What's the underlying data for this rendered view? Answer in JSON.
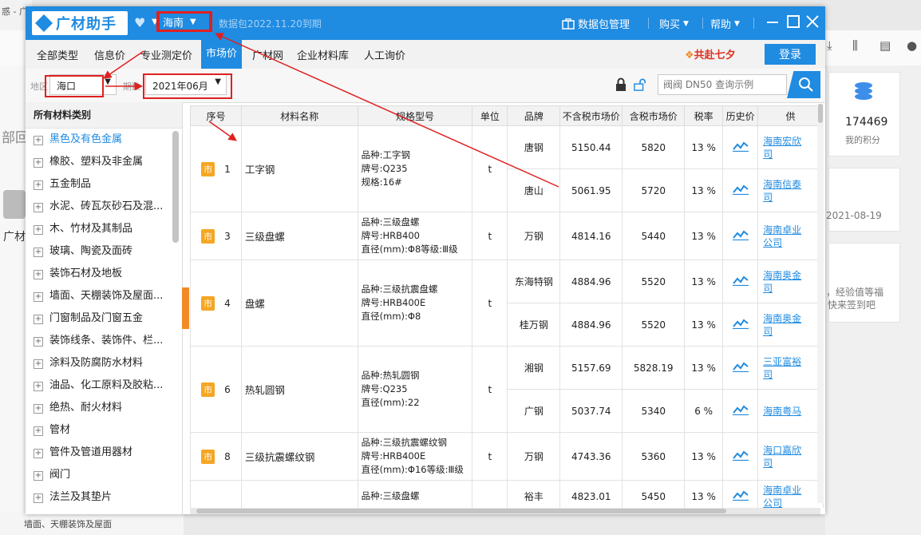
{
  "background": {
    "tab_text": "惑 - 广",
    "points_value": "174469",
    "points_label": "我的积分",
    "date_text": "2021-08-19",
    "checkin_line1": "，经验值等福",
    "checkin_line2": "快来签到吧",
    "side_text_1": "部回",
    "side_text_2": "广材",
    "bottom_text": "墙面、天棚装饰及屋面"
  },
  "app": {
    "logo_text": "广材助手",
    "region": "海南",
    "package_expiry": "数据包2022.11.20到期",
    "package_manage": "数据包管理",
    "buy": "购买",
    "help": "帮助"
  },
  "nav": {
    "tabs": [
      "全部类型",
      "信息价",
      "专业测定价",
      "市场价",
      "广材网",
      "企业材料库",
      "人工询价"
    ],
    "active_tab": "市场价",
    "promo": "共赴七夕",
    "login": "登录"
  },
  "filters": {
    "area_label": "地区",
    "area_value": "海口",
    "period_label": "期数",
    "period_value": "2021年06月",
    "search_placeholder": "阀阀 DN50 查询示例"
  },
  "sidebar": {
    "header": "所有材料类别",
    "active_index": 0,
    "items": [
      "黑色及有色金属",
      "橡胶、塑料及非金属",
      "五金制品",
      "水泥、砖瓦灰砂石及混...",
      "木、竹材及其制品",
      "玻璃、陶瓷及面砖",
      "装饰石材及地板",
      "墙面、天棚装饰及屋面...",
      "门窗制品及门窗五金",
      "装饰线条、装饰件、栏...",
      "涂料及防腐防水材料",
      "油品、化工原料及胶粘...",
      "绝热、耐火材料",
      "管材",
      "管件及管道用器材",
      "阀门",
      "法兰及其垫片"
    ]
  },
  "table": {
    "badge": "市",
    "headers": [
      "序号",
      "材料名称",
      "规格型号",
      "单位",
      "品牌",
      "不含税市场价",
      "含税市场价",
      "税率",
      "历史价",
      "供"
    ],
    "groups": [
      {
        "no": "1",
        "name": "工字钢",
        "spec": [
          "品种:工字钢",
          "牌号:Q235",
          "规格:16#"
        ],
        "unit": "t",
        "rows": [
          {
            "brand": "唐钢",
            "price_ex": "5150.44",
            "price_in": "5820",
            "tax": "13 %",
            "supplier": [
              "海南宏欣",
              "司"
            ]
          },
          {
            "brand": "唐山",
            "price_ex": "5061.95",
            "price_in": "5720",
            "tax": "13 %",
            "supplier": [
              "海南信泰",
              "司"
            ]
          }
        ]
      },
      {
        "no": "3",
        "name": "三级盘螺",
        "spec": [
          "品种:三级盘螺",
          "牌号:HRB400",
          "直径(mm):Φ8等级:Ⅲ级"
        ],
        "unit": "t",
        "rows": [
          {
            "brand": "万钢",
            "price_ex": "4814.16",
            "price_in": "5440",
            "tax": "13 %",
            "supplier": [
              "海南卓业",
              "公司"
            ]
          }
        ]
      },
      {
        "no": "4",
        "name": "盘螺",
        "spec": [
          "品种:三级抗震盘螺",
          "牌号:HRB400E",
          "直径(mm):Φ8"
        ],
        "unit": "t",
        "rows": [
          {
            "brand": "东海特钢",
            "price_ex": "4884.96",
            "price_in": "5520",
            "tax": "13 %",
            "supplier": [
              "海南奥金",
              "司"
            ]
          },
          {
            "brand": "桂万钢",
            "price_ex": "4884.96",
            "price_in": "5520",
            "tax": "13 %",
            "supplier": [
              "海南奥金",
              "司"
            ]
          }
        ]
      },
      {
        "no": "6",
        "name": "热轧圆钢",
        "spec": [
          "品种:热轧圆钢",
          "牌号:Q235",
          "直径(mm):22"
        ],
        "unit": "t",
        "rows": [
          {
            "brand": "湘钢",
            "price_ex": "5157.69",
            "price_in": "5828.19",
            "tax": "13 %",
            "supplier": [
              "三亚富裕",
              "司"
            ]
          },
          {
            "brand": "广钢",
            "price_ex": "5037.74",
            "price_in": "5340",
            "tax": "6 %",
            "supplier": [
              "海南粤马"
            ]
          }
        ]
      },
      {
        "no": "8",
        "name": "三级抗震螺纹钢",
        "spec": [
          "品种:三级抗震螺纹钢",
          "牌号:HRB400E",
          "直径(mm):Φ16等级:Ⅲ级"
        ],
        "unit": "t",
        "rows": [
          {
            "brand": "万钢",
            "price_ex": "4743.36",
            "price_in": "5360",
            "tax": "13 %",
            "supplier": [
              "海口嘉欣",
              "司"
            ]
          }
        ]
      },
      {
        "no": "",
        "name": "",
        "spec": [
          "品种:三级盘螺"
        ],
        "unit": "",
        "rows": [
          {
            "brand": "裕丰",
            "price_ex": "4823.01",
            "price_in": "5450",
            "tax": "13 %",
            "supplier": [
              "海南卓业",
              "公司"
            ]
          }
        ]
      }
    ]
  },
  "colors": {
    "accent": "#1f8be1",
    "annotation_red": "#e02020",
    "badge_orange": "#f5a623"
  }
}
